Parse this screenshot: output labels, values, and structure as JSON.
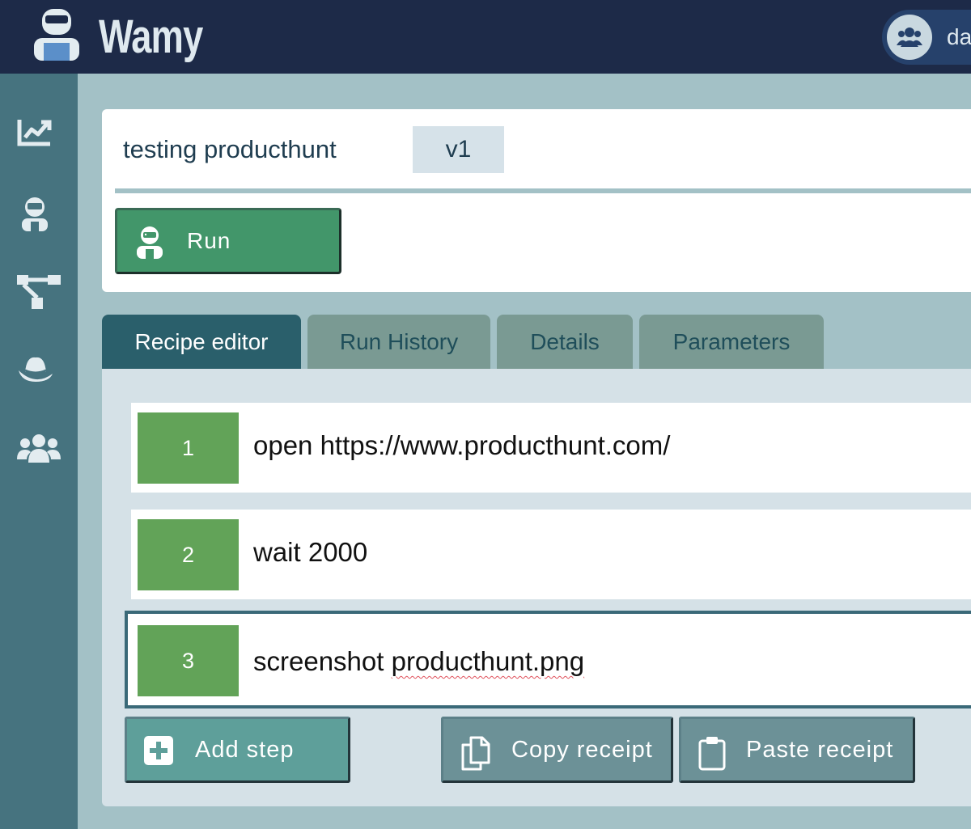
{
  "app": {
    "name": "Wamy",
    "user_name": "da"
  },
  "nav": {
    "items": [
      "chart-line-icon",
      "robot-icon",
      "flow-diagram-icon",
      "hat-icon",
      "users-icon"
    ]
  },
  "recipe": {
    "name": "testing producthunt",
    "version": "v1",
    "run_label": "Run"
  },
  "tabs": [
    {
      "label": "Recipe editor",
      "active": true
    },
    {
      "label": "Run History",
      "active": false
    },
    {
      "label": "Details",
      "active": false
    },
    {
      "label": "Parameters",
      "active": false
    }
  ],
  "steps": [
    {
      "number": "1",
      "command": "open https://www.producthunt.com/"
    },
    {
      "number": "2",
      "command": "wait 2000"
    },
    {
      "number": "3",
      "command_prefix": "screenshot ",
      "command_flagged": "producthunt.png",
      "selected": true
    }
  ],
  "actions": {
    "add_step": "Add step",
    "copy_receipt": "Copy receipt",
    "paste_receipt": "Paste receipt"
  },
  "colors": {
    "topbar": "#1d2a48",
    "sidenav": "#46737f",
    "accent_green": "#42966a",
    "step_number_green": "#62a358",
    "active_tab": "#2a5f6b",
    "inactive_tab": "#7a9a93"
  }
}
